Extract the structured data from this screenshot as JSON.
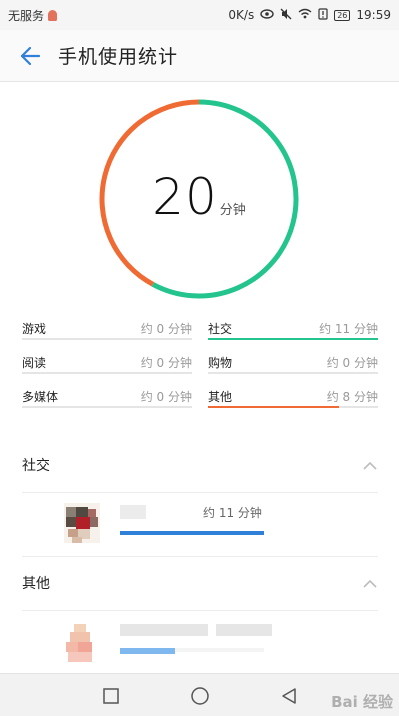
{
  "status_bar": {
    "carrier": "无服务",
    "speed": "0K/s",
    "battery": "26",
    "time": "19:59",
    "icons": [
      "sim-alert-icon",
      "eye-icon",
      "mute-icon",
      "wifi-icon",
      "alert-icon",
      "battery-icon"
    ]
  },
  "header": {
    "title": "手机使用统计",
    "back_icon": "back-arrow-icon"
  },
  "summary": {
    "total": "20",
    "unit": "分钟",
    "ring": [
      {
        "name": "社交",
        "minutes": 11,
        "color": "#23c48e"
      },
      {
        "name": "其他",
        "minutes": 8,
        "color": "#ef6b33"
      }
    ]
  },
  "categories": [
    {
      "label": "游戏",
      "value": "约 0 分钟",
      "fraction": 0,
      "color": "#23c48e"
    },
    {
      "label": "社交",
      "value": "约 11 分钟",
      "fraction": 1.0,
      "color": "#23c48e"
    },
    {
      "label": "阅读",
      "value": "约 0 分钟",
      "fraction": 0,
      "color": "#23c48e"
    },
    {
      "label": "购物",
      "value": "约 0 分钟",
      "fraction": 0,
      "color": "#23c48e"
    },
    {
      "label": "多媒体",
      "value": "约 0 分钟",
      "fraction": 0,
      "color": "#23c48e"
    },
    {
      "label": "其他",
      "value": "约 8 分钟",
      "fraction": 0.77,
      "color": "#ef6b33"
    }
  ],
  "sections": [
    {
      "title": "社交",
      "apps": [
        {
          "usage": "约 11 分钟",
          "fraction": 1.0,
          "bar_color": "#2f80d8"
        }
      ]
    },
    {
      "title": "其他",
      "apps": [
        {
          "usage": "",
          "fraction": 0.38,
          "bar_color": "#7fb8ee"
        }
      ]
    }
  ],
  "nav": {
    "icons": [
      "recent-apps-icon",
      "home-icon",
      "back-icon"
    ]
  },
  "watermark": "Bai 经验"
}
